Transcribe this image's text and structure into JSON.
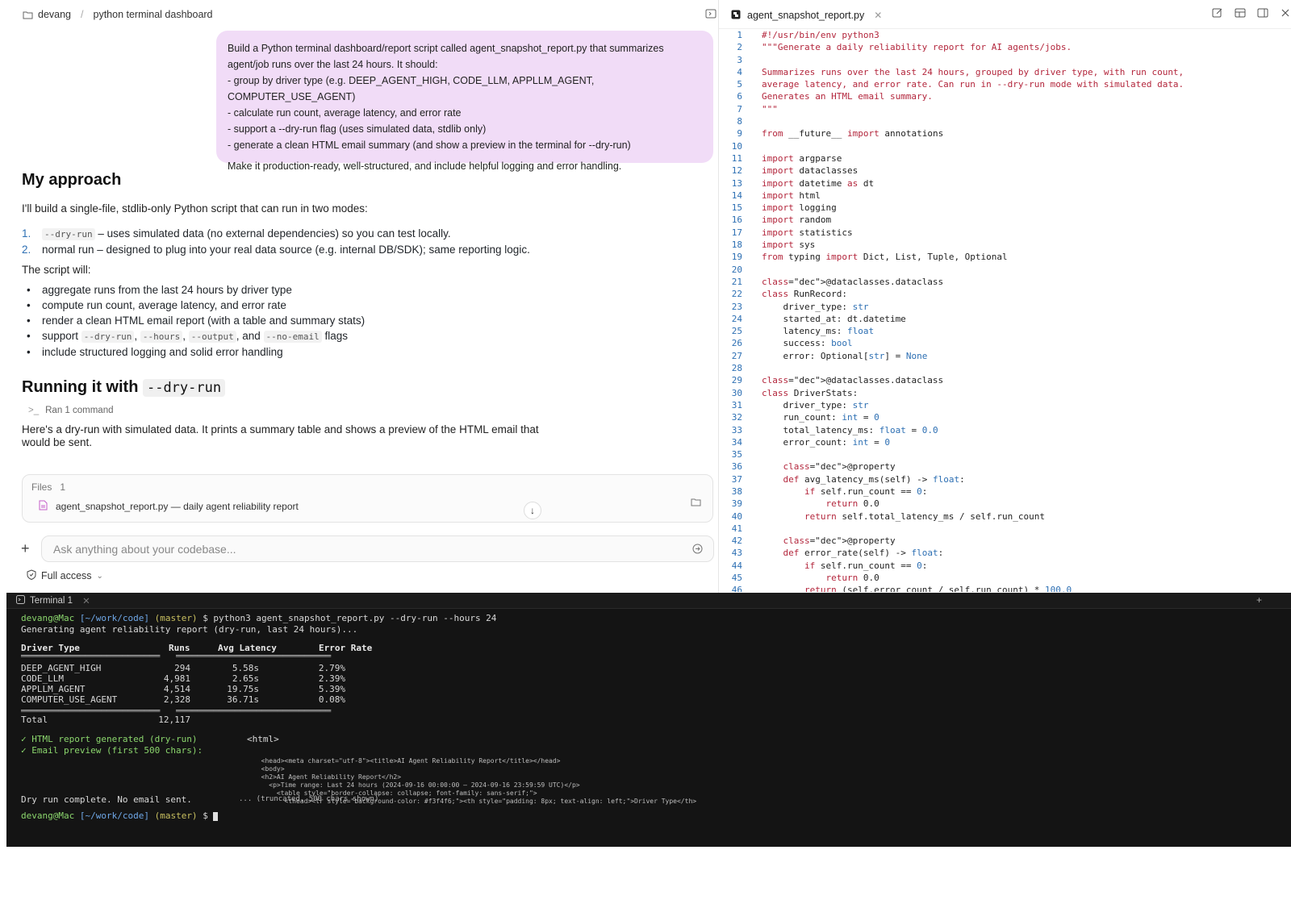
{
  "breadcrumb": {
    "workspace": "devang",
    "separator": "/",
    "project": "python terminal dashboard"
  },
  "prompt_bubble": {
    "intro": "Build a Python terminal dashboard/report script called agent_snapshot_report.py that summarizes agent/job runs over the last 24 hours. It should:",
    "items": [
      "- group by driver type (e.g. DEEP_AGENT_HIGH, CODE_LLM, APPLLM_AGENT, COMPUTER_USE_AGENT)",
      "- calculate run count, average latency, and error rate",
      "- support a --dry-run flag (uses simulated data, stdlib only)",
      "- generate a clean HTML email summary (and show a preview in the terminal for --dry-run)"
    ],
    "closing": "Make it production-ready, well-structured, and include helpful logging and error handling."
  },
  "approach": {
    "heading": "My approach",
    "intro": "I'll build a single-file, stdlib-only Python script that can run in two modes:",
    "steps": [
      {
        "num": "1.",
        "code": "--dry-run",
        "text": " – uses simulated data (no external dependencies) so you can test locally."
      },
      {
        "num": "2.",
        "code": "",
        "text": "normal run – designed to plug into your real data source (e.g. internal DB/SDK); same reporting logic."
      }
    ],
    "will_label": "The script will:",
    "bullets": [
      "aggregate runs from the last 24 hours by driver type",
      "compute run count, average latency, and error rate",
      "render a clean HTML email report (with a table and summary stats)"
    ],
    "flags_bullet": {
      "pre": "support ",
      "f1": "--dry-run",
      "c1": ", ",
      "f2": "--hours",
      "c2": ", ",
      "f3": "--output",
      "c3": ", and ",
      "f4": "--no-email",
      "post": " flags"
    },
    "last_bullet": "include structured logging and solid error handling"
  },
  "running": {
    "heading_text": "Running it with ",
    "heading_code": "--dry-run",
    "ran_label": "Ran 1 command",
    "desc": "Here's a dry-run with simulated data. It prints a summary table and shows a preview of the HTML email that would be sent."
  },
  "files_panel": {
    "label": "Files",
    "count": "1",
    "file_name": "agent_snapshot_report.py — daily agent reliability report"
  },
  "composer": {
    "placeholder": "Ask anything about your codebase...",
    "access_label": "Full access"
  },
  "editor": {
    "tab_name": "agent_snapshot_report.py",
    "lines": [
      "#!/usr/bin/env python3",
      "\"\"\"Generate a daily reliability report for AI agents/jobs.",
      "",
      "Summarizes runs over the last 24 hours, grouped by driver type, with run count,",
      "average latency, and error rate. Can run in --dry-run mode with simulated data.",
      "Generates an HTML email summary.",
      "\"\"\"",
      "",
      "from __future__ import annotations",
      "",
      "import argparse",
      "import dataclasses",
      "import datetime as dt",
      "import html",
      "import logging",
      "import random",
      "import statistics",
      "import sys",
      "from typing import Dict, List, Tuple, Optional",
      "",
      "@dataclasses.dataclass",
      "class RunRecord:",
      "    driver_type: str",
      "    started_at: dt.datetime",
      "    latency_ms: float",
      "    success: bool",
      "    error: Optional[str] = None",
      "",
      "@dataclasses.dataclass",
      "class DriverStats:",
      "    driver_type: str",
      "    run_count: int = 0",
      "    total_latency_ms: float = 0.0",
      "    error_count: int = 0",
      "",
      "    @property",
      "    def avg_latency_ms(self) -> float:",
      "        if self.run_count == 0:",
      "            return 0.0",
      "        return self.total_latency_ms / self.run_count",
      "",
      "    @property",
      "    def error_rate(self) -> float:",
      "        if self.run_count == 0:",
      "            return 0.0",
      "        return (self.error_count / self.run_count) * 100.0"
    ]
  },
  "terminal": {
    "tab_name": "Terminal 1",
    "prompt_user": "devang@Mac",
    "prompt_dir": "[~/work/code]",
    "prompt_branch": "(master)",
    "command": "$ python3 agent_snapshot_report.py --dry-run --hours 24",
    "generating": "Generating agent reliability report (dry-run, last 24 hours)...",
    "headers": [
      "Driver Type",
      "Runs",
      "Avg Latency",
      "Error Rate"
    ],
    "rows": [
      [
        "DEEP_AGENT_HIGH",
        "294",
        "5.58s",
        "2.79%"
      ],
      [
        "CODE_LLM",
        "4,981",
        "2.65s",
        "2.39%"
      ],
      [
        "APPLLM_AGENT",
        "4,514",
        "19.75s",
        "5.39%"
      ],
      [
        "COMPUTER_USE_AGENT",
        "2,328",
        "36.71s",
        "0.08%"
      ]
    ],
    "total_label": "Total",
    "total_runs": "12,117",
    "check1": "✓ HTML report generated (dry-run)",
    "check2": "✓ Email preview (first 500 chars):",
    "html_tag": "<html>",
    "html_preview": "  <head><meta charset=\"utf-8\"><title>AI Agent Reliability Report</title></head>\n  <body>\n  <h2>AI Agent Reliability Report</h2>\n    <p>Time range: Last 24 hours (2024-09-16 00:00:00 – 2024-09-16 23:59:59 UTC)</p>\n      <table style=\"border-collapse: collapse; font-family: sans-serif;\">\n        <thead><tr style=\"background-color: #f3f4f6;\"><th style=\"padding: 8px; text-align: left;\">Driver Type</th>",
    "done": "Dry run complete. No email sent.",
    "truncated": "... (truncated, 500 chars shown)",
    "final_prompt_sym": "$"
  }
}
